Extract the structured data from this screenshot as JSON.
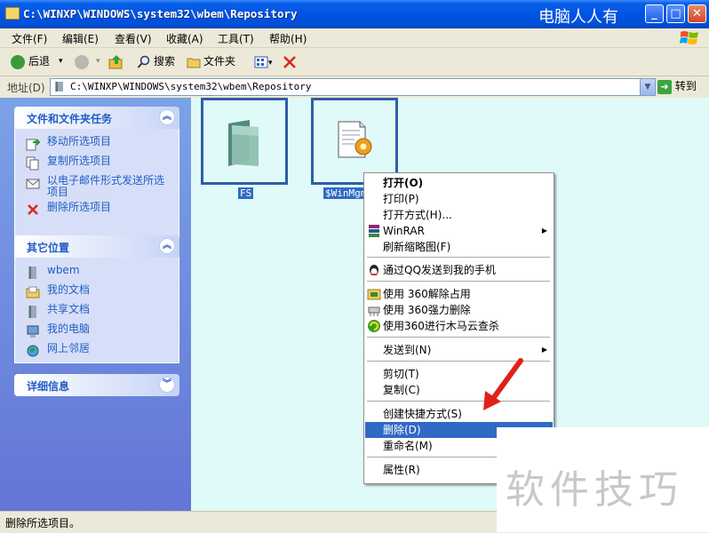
{
  "window": {
    "title": "C:\\WINXP\\WINDOWS\\system32\\wbem\\Repository",
    "watermark": "电脑人人有",
    "min": "_",
    "max": "□",
    "close": "✕"
  },
  "menubar": {
    "items": [
      "文件(F)",
      "编辑(E)",
      "查看(V)",
      "收藏(A)",
      "工具(T)",
      "帮助(H)"
    ]
  },
  "toolbar": {
    "back": "后退",
    "back_drop": "▾",
    "forward_drop": "▾",
    "search": "搜索",
    "folders": "文件夹",
    "views_drop": "▾"
  },
  "address": {
    "label": "地址(D)",
    "value": "C:\\WINXP\\WINDOWS\\system32\\wbem\\Repository",
    "go": "转到"
  },
  "tasks_panel": {
    "title": "文件和文件夹任务",
    "items": [
      "移动所选项目",
      "复制所选项目",
      "以电子邮件形式发送所选项目",
      "删除所选项目"
    ]
  },
  "places_panel": {
    "title": "其它位置",
    "items": [
      "wbem",
      "我的文档",
      "共享文档",
      "我的电脑",
      "网上邻居"
    ]
  },
  "details_panel": {
    "title": "详细信息"
  },
  "files": [
    {
      "name": "FS",
      "icon": "folder-icon"
    },
    {
      "name": "$WinMgm",
      "icon": "config-file-icon"
    }
  ],
  "context_menu": {
    "items": [
      {
        "label": "打开(O)",
        "bold": true
      },
      {
        "label": "打印(P)"
      },
      {
        "label": "打开方式(H)..."
      },
      {
        "label": "WinRAR",
        "submenu": true,
        "icon": "winrar-icon"
      },
      {
        "label": "刷新缩略图(F)"
      },
      {
        "label": "通过QQ发送到我的手机",
        "icon": "qq-icon"
      },
      {
        "label": "使用 360解除占用",
        "icon": "unlock-icon"
      },
      {
        "label": "使用 360强力删除",
        "icon": "shredder-icon"
      },
      {
        "label": "使用360进行木马云查杀",
        "icon": "360-icon"
      },
      {
        "label": "发送到(N)",
        "submenu": true
      },
      {
        "label": "剪切(T)"
      },
      {
        "label": "复制(C)"
      },
      {
        "label": "创建快捷方式(S)"
      },
      {
        "label": "删除(D)",
        "selected": true
      },
      {
        "label": "重命名(M)"
      },
      {
        "label": "属性(R)"
      }
    ],
    "submenu_arrow": "▶"
  },
  "status": {
    "text": "删除所选项目。"
  },
  "overlay": {
    "watermark": "软件技巧"
  },
  "colors": {
    "selection": "#316AC5",
    "titlebar": "#0054E3",
    "content_bg": "#E0FAFA",
    "annotation_arrow": "#E0201A"
  }
}
